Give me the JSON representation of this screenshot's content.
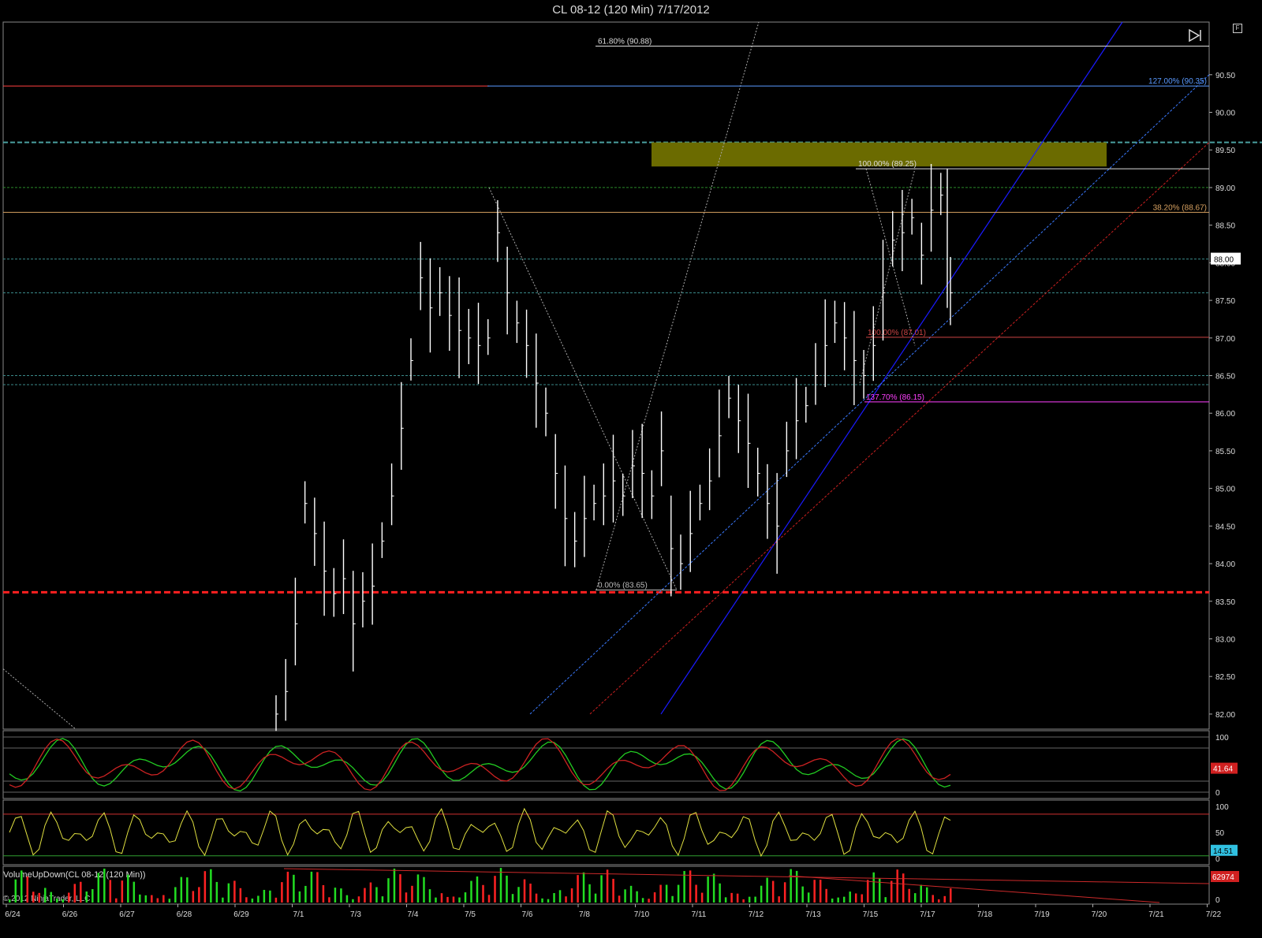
{
  "title": "CL 08-12 (120 Min)  7/17/2012",
  "copyright": "© 2012 NinjaTrader, LLC",
  "volume_label": "VolumeUpDown(CL 08-12 (120 Min))",
  "f_button": "F",
  "colors": {
    "background": "#000000",
    "bars": "#ffffff",
    "red_support": "#ff2020",
    "zone": "#6b6b00",
    "fib_orange": "#d6a060",
    "fib_magenta": "#ff40ff",
    "blue_trend": "#1a1aff",
    "dashed_blue": "#3a7aff",
    "stoch_green": "#22cc22",
    "stoch_red": "#cc2222",
    "osc_yellow": "#e0e040",
    "osc_cyan": "#40e0ff",
    "vol_up": "#22dd22",
    "vol_down": "#ff2222"
  },
  "chart_data": {
    "type": "line",
    "title": "CL 08-12 (120 Min)  7/17/2012",
    "x_ticks": [
      "6/24",
      "6/26",
      "6/27",
      "6/28",
      "6/29",
      "7/1",
      "7/3",
      "7/4",
      "7/5",
      "7/6",
      "7/8",
      "7/10",
      "7/11",
      "7/12",
      "7/13",
      "7/15",
      "7/17",
      "7/18",
      "7/19",
      "7/20",
      "7/21",
      "7/22"
    ],
    "y_ticks": [
      82.0,
      82.5,
      83.0,
      83.5,
      84.0,
      84.5,
      85.0,
      85.5,
      86.0,
      86.5,
      87.0,
      87.5,
      88.0,
      88.5,
      89.0,
      89.5,
      90.0,
      90.5
    ],
    "ylim": [
      81.8,
      91.2
    ],
    "last_price": "88.00",
    "price_series": [
      82.0,
      82.3,
      83.2,
      84.8,
      84.4,
      83.9,
      83.6,
      83.8,
      83.2,
      83.5,
      83.7,
      84.3,
      84.9,
      85.8,
      86.7,
      87.8,
      87.4,
      87.6,
      87.3,
      87.1,
      87.0,
      86.9,
      87.0,
      88.4,
      87.6,
      87.2,
      86.9,
      86.4,
      86.0,
      85.2,
      84.6,
      84.3,
      84.6,
      84.8,
      84.9,
      85.1,
      84.9,
      85.3,
      85.2,
      84.9,
      85.5,
      84.2,
      84.0,
      84.4,
      84.8,
      85.1,
      85.7,
      86.2,
      85.9,
      85.6,
      85.2,
      84.8,
      84.5,
      85.5,
      85.9,
      86.1,
      86.5,
      86.9,
      87.2,
      87.0,
      86.7,
      86.5,
      86.9,
      87.6,
      88.3,
      88.4,
      88.6,
      88.1,
      88.7,
      88.9,
      87.6
    ],
    "horizontal_levels": [
      {
        "label": "61.80% (90.88)",
        "value": 90.88
      },
      {
        "label": "127.00% (90.35)",
        "value": 90.35
      },
      {
        "label": "100.00% (89.25)",
        "value": 89.25
      },
      {
        "label": "38.20% (88.67)",
        "value": 88.67
      },
      {
        "label": "100.00% (87.01)",
        "value": 87.01
      },
      {
        "label": "137.70% (86.15)",
        "value": 86.15
      },
      {
        "label": "0.00% (83.65)",
        "value": 83.65
      }
    ],
    "support_level": 83.62,
    "resistance_zone": [
      89.28,
      89.6
    ],
    "indicators": [
      {
        "name": "stochastic",
        "ticks": [
          "100",
          "0"
        ],
        "last_value": "41.64"
      },
      {
        "name": "oscillator",
        "ticks": [
          "100",
          "50",
          "0"
        ],
        "last_value": "14.51"
      },
      {
        "name": "VolumeUpDown(CL 08-12 (120 Min))",
        "ticks": [
          "0"
        ],
        "last_value": "62974"
      }
    ]
  }
}
